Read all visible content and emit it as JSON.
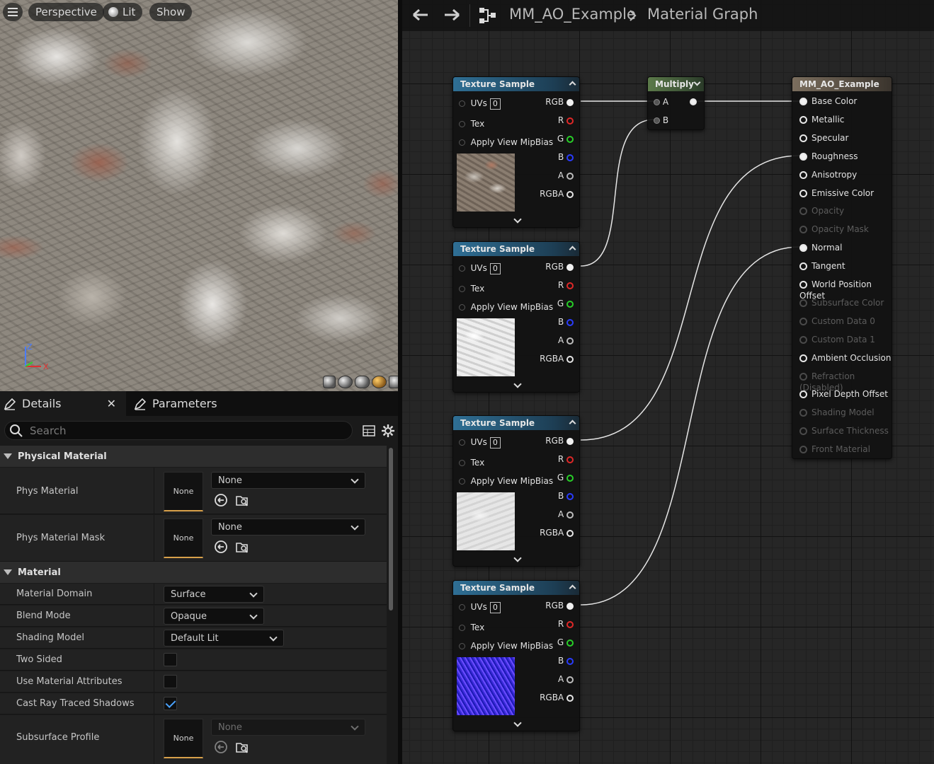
{
  "viewport": {
    "perspective_label": "Perspective",
    "lit_label": "Lit",
    "show_label": "Show",
    "axis_z": "Z",
    "axis_x": "X"
  },
  "details": {
    "tab_details": "Details",
    "tab_parameters": "Parameters",
    "search_placeholder": "Search",
    "categories": {
      "physical": "Physical Material",
      "material": "Material"
    },
    "rows": {
      "phys_material": {
        "label": "Phys Material",
        "thumb": "None",
        "value": "None"
      },
      "phys_material_mask": {
        "label": "Phys Material Mask",
        "thumb": "None",
        "value": "None"
      },
      "material_domain": {
        "label": "Material Domain",
        "value": "Surface"
      },
      "blend_mode": {
        "label": "Blend Mode",
        "value": "Opaque"
      },
      "shading_model": {
        "label": "Shading Model",
        "value": "Default Lit"
      },
      "two_sided": {
        "label": "Two Sided",
        "checked": false
      },
      "use_material_attributes": {
        "label": "Use Material Attributes",
        "checked": false
      },
      "cast_ray_traced_shadows": {
        "label": "Cast Ray Traced Shadows",
        "checked": true
      },
      "subsurface_profile": {
        "label": "Subsurface Profile",
        "thumb": "None",
        "value": "None"
      }
    }
  },
  "graph": {
    "breadcrumb_root": "MM_AO_Example",
    "breadcrumb_current": "Material Graph",
    "texture_node": {
      "title": "Texture Sample",
      "uvs": "UVs",
      "uv_index": "0",
      "tex": "Tex",
      "mipbias": "Apply View MipBias",
      "outputs": [
        "RGB",
        "R",
        "G",
        "B",
        "A",
        "RGBA"
      ]
    },
    "multiply_node": {
      "title": "Multiply",
      "in_a": "A",
      "in_b": "B"
    },
    "material_node": {
      "title": "MM_AO_Example",
      "pins": [
        {
          "label": "Base Color",
          "enabled": true,
          "connected": true
        },
        {
          "label": "Metallic",
          "enabled": true,
          "connected": false
        },
        {
          "label": "Specular",
          "enabled": true,
          "connected": false
        },
        {
          "label": "Roughness",
          "enabled": true,
          "connected": true
        },
        {
          "label": "Anisotropy",
          "enabled": true,
          "connected": false
        },
        {
          "label": "Emissive Color",
          "enabled": true,
          "connected": false
        },
        {
          "label": "Opacity",
          "enabled": false,
          "connected": false
        },
        {
          "label": "Opacity Mask",
          "enabled": false,
          "connected": false
        },
        {
          "label": "Normal",
          "enabled": true,
          "connected": true
        },
        {
          "label": "Tangent",
          "enabled": true,
          "connected": false
        },
        {
          "label": "World Position Offset",
          "enabled": true,
          "connected": false
        },
        {
          "label": "Subsurface Color",
          "enabled": false,
          "connected": false
        },
        {
          "label": "Custom Data 0",
          "enabled": false,
          "connected": false
        },
        {
          "label": "Custom Data 1",
          "enabled": false,
          "connected": false
        },
        {
          "label": "Ambient Occlusion",
          "enabled": true,
          "connected": false
        },
        {
          "label": "Refraction (Disabled)",
          "enabled": false,
          "connected": false
        },
        {
          "label": "Pixel Depth Offset",
          "enabled": true,
          "connected": false
        },
        {
          "label": "Shading Model",
          "enabled": false,
          "connected": false
        },
        {
          "label": "Surface Thickness",
          "enabled": false,
          "connected": false
        },
        {
          "label": "Front Material",
          "enabled": false,
          "connected": false
        }
      ]
    },
    "colors": {
      "pin_r": "#e02828",
      "pin_g": "#28d028",
      "pin_b": "#2a3cff",
      "accent": "#d8a04a"
    }
  }
}
